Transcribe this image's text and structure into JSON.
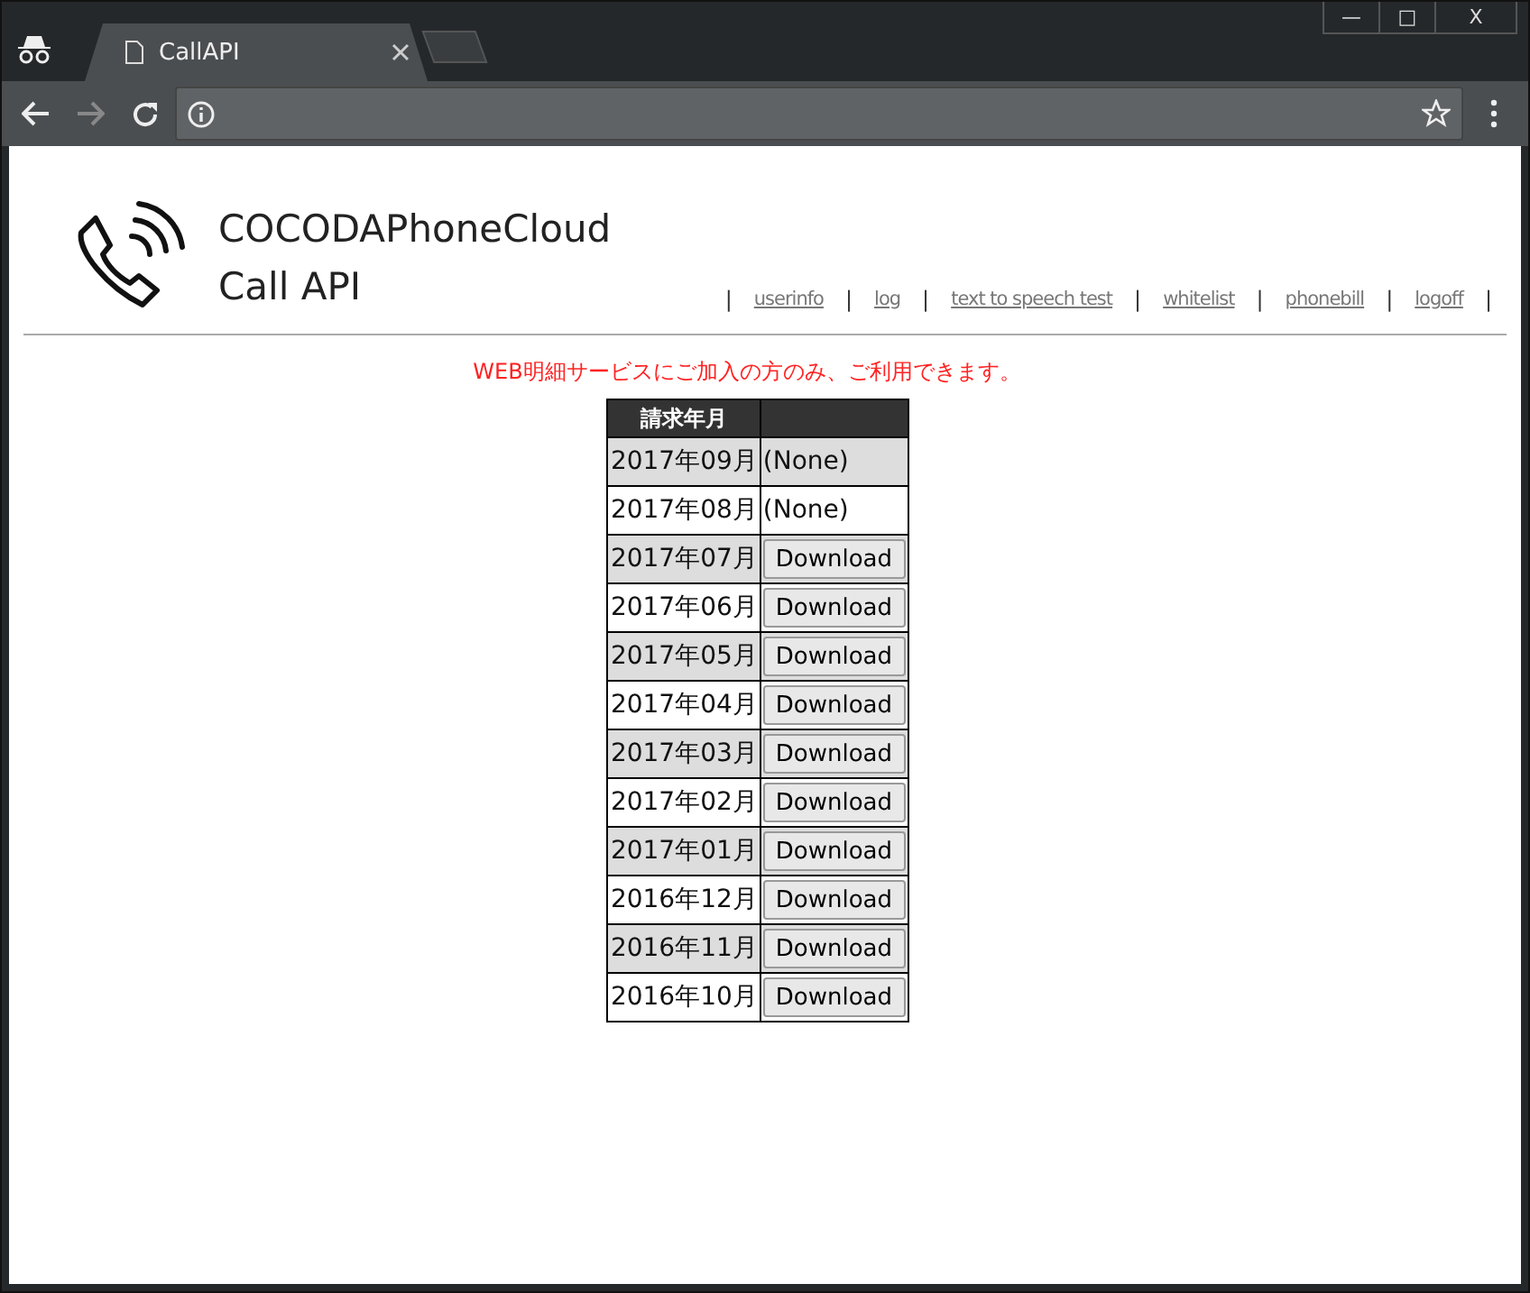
{
  "browser": {
    "tab_title": "CallAPI",
    "window_controls": [
      "—",
      "□",
      "X"
    ]
  },
  "site": {
    "title_line1": "COCODAPhoneCloud",
    "title_line2": "Call API",
    "nav": [
      {
        "label": "userinfo"
      },
      {
        "label": "log"
      },
      {
        "label": "text to speech test"
      },
      {
        "label": "whitelist"
      },
      {
        "label": "phonebill"
      },
      {
        "label": "logoff"
      }
    ],
    "separator": "|"
  },
  "notice": "WEB明細サービスにご加入の方のみ、ご利用できます。",
  "table": {
    "columns": [
      "請求年月"
    ],
    "rows": [
      {
        "month": "2017年09月",
        "kind": "none",
        "text": "(None)"
      },
      {
        "month": "2017年08月",
        "kind": "none",
        "text": "(None)"
      },
      {
        "month": "2017年07月",
        "kind": "download",
        "text": "Download"
      },
      {
        "month": "2017年06月",
        "kind": "download",
        "text": "Download"
      },
      {
        "month": "2017年05月",
        "kind": "download",
        "text": "Download"
      },
      {
        "month": "2017年04月",
        "kind": "download",
        "text": "Download"
      },
      {
        "month": "2017年03月",
        "kind": "download",
        "text": "Download"
      },
      {
        "month": "2017年02月",
        "kind": "download",
        "text": "Download"
      },
      {
        "month": "2017年01月",
        "kind": "download",
        "text": "Download"
      },
      {
        "month": "2016年12月",
        "kind": "download",
        "text": "Download"
      },
      {
        "month": "2016年11月",
        "kind": "download",
        "text": "Download"
      },
      {
        "month": "2016年10月",
        "kind": "download",
        "text": "Download"
      }
    ]
  }
}
